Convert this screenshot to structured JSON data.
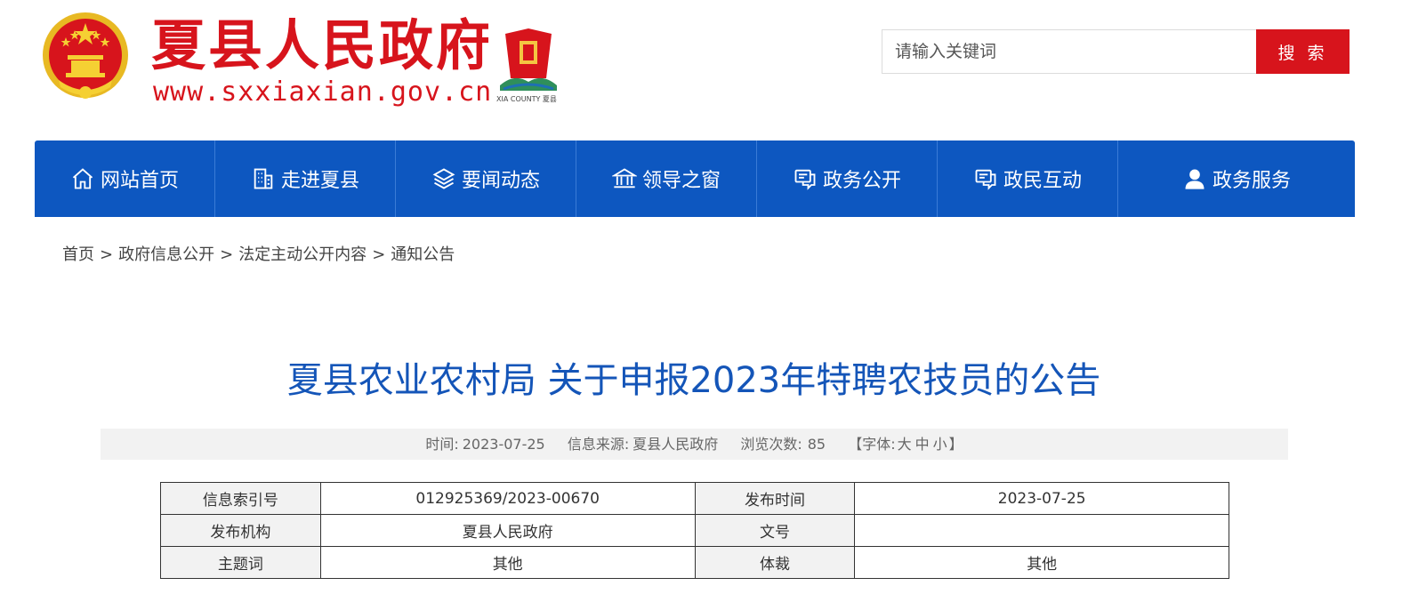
{
  "header": {
    "site_title": "夏县人民政府",
    "site_url": "www.sxxiaxian.gov.cn",
    "county_logo_caption": "XIA COUNTY 夏县"
  },
  "search": {
    "placeholder": "请输入关键词",
    "button_label": "搜 索"
  },
  "nav": {
    "items": [
      {
        "label": "网站首页",
        "icon": "home-icon"
      },
      {
        "label": "走进夏县",
        "icon": "building-icon"
      },
      {
        "label": "要闻动态",
        "icon": "layers-icon"
      },
      {
        "label": "领导之窗",
        "icon": "government-building-icon"
      },
      {
        "label": "政务公开",
        "icon": "chat-icon"
      },
      {
        "label": "政民互动",
        "icon": "chat-icon"
      },
      {
        "label": "政务服务",
        "icon": "user-icon"
      }
    ]
  },
  "breadcrumb": {
    "items": [
      "首页",
      "政府信息公开",
      "法定主动公开内容",
      "通知公告"
    ],
    "separator": ">"
  },
  "article": {
    "title": "夏县农业农村局 关于申报2023年特聘农技员的公告",
    "meta": {
      "time_label": "时间:",
      "time_value": "2023-07-25",
      "source_label": "信息来源:",
      "source_value": "夏县人民政府",
      "views_label": "浏览次数:",
      "views_value": "85",
      "font_label": "【字体:",
      "font_large": "大",
      "font_medium": "中",
      "font_small": "小",
      "font_close": "】"
    }
  },
  "info_table": {
    "rows": [
      {
        "label1": "信息索引号",
        "value1": "012925369/2023-00670",
        "label2": "发布时间",
        "value2": "2023-07-25"
      },
      {
        "label1": "发布机构",
        "value1": "夏县人民政府",
        "label2": "文号",
        "value2": ""
      },
      {
        "label1": "主题词",
        "value1": "其他",
        "label2": "体裁",
        "value2": "其他"
      }
    ]
  },
  "colors": {
    "brand_red": "#d7141c",
    "nav_blue": "#0d57c0",
    "title_blue": "#1455b8"
  }
}
